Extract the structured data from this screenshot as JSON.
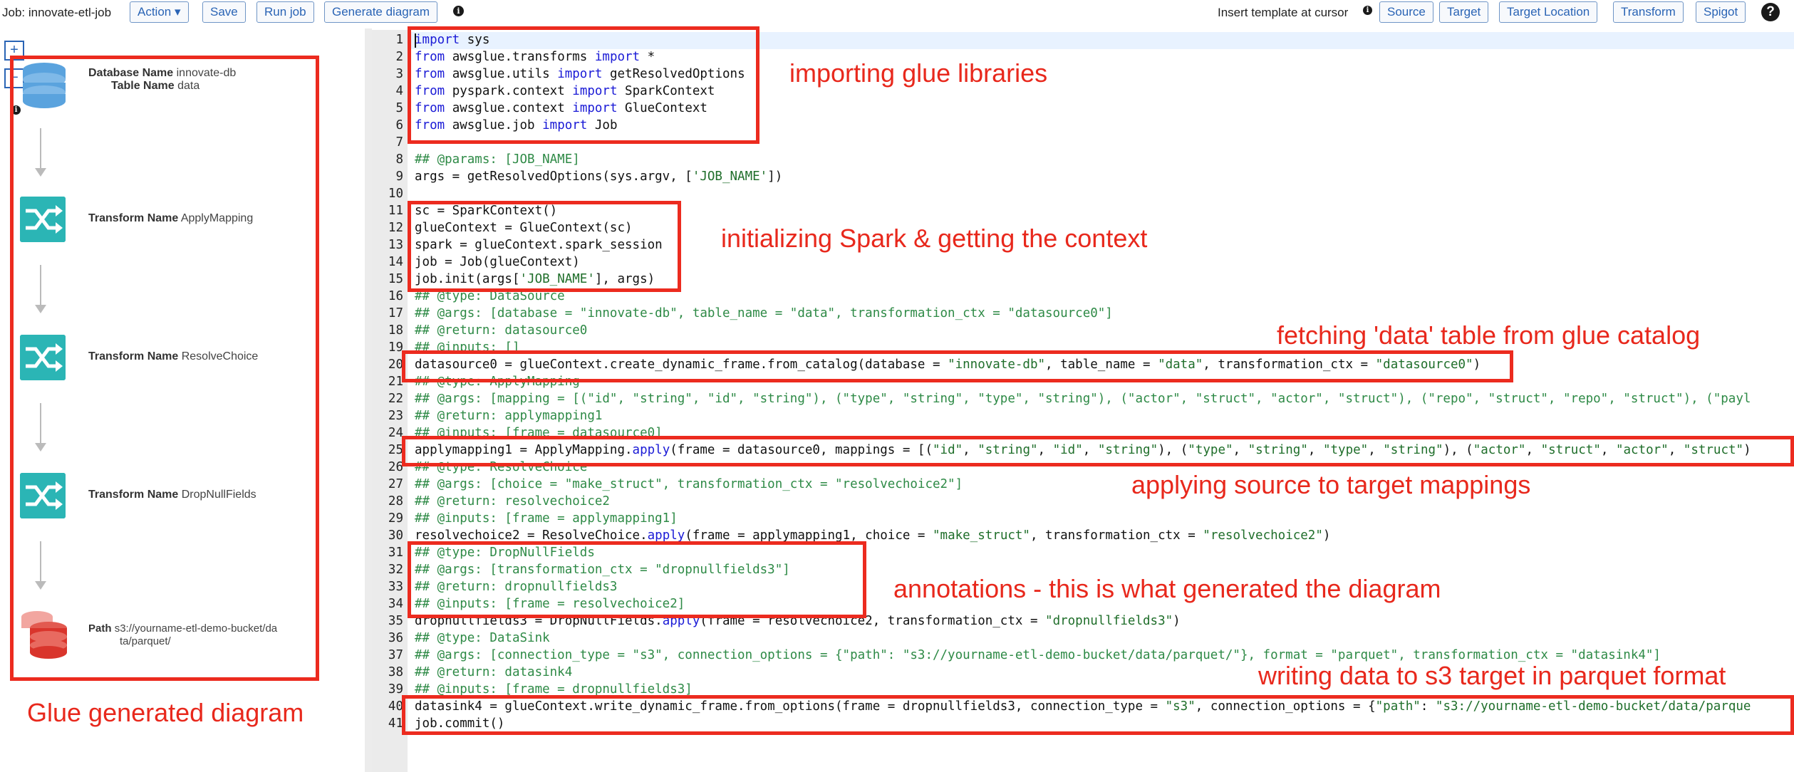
{
  "toolbar": {
    "job_label": "Job: innovate-etl-job",
    "action_label": "Action ▾",
    "save_label": "Save",
    "run_label": "Run job",
    "generate_label": "Generate diagram",
    "insert_template_label": "Insert template at cursor",
    "source_label": "Source",
    "target_label": "Target",
    "target_location_label": "Target Location",
    "transform_label": "Transform",
    "spigot_label": "Spigot",
    "help_label": "?"
  },
  "diagram": {
    "zoom_in": "+",
    "zoom_out": "−",
    "source_node": {
      "db_key": "Database Name",
      "db_value": "innovate-db",
      "table_key": "Table Name",
      "table_value": "data"
    },
    "transforms": [
      {
        "key": "Transform Name",
        "value": "ApplyMapping"
      },
      {
        "key": "Transform Name",
        "value": "ResolveChoice"
      },
      {
        "key": "Transform Name",
        "value": "DropNullFields"
      }
    ],
    "sink_node": {
      "path_key": "Path",
      "path_line1": "s3://yourname-etl-demo-bucket/da",
      "path_line2": "ta/parquet/"
    }
  },
  "code": {
    "line_numbers": [
      "1",
      "2",
      "3",
      "4",
      "5",
      "6",
      "7",
      "8",
      "9",
      "10",
      "11",
      "12",
      "13",
      "14",
      "15",
      "16",
      "17",
      "18",
      "19",
      "20",
      "21",
      "22",
      "23",
      "24",
      "25",
      "26",
      "27",
      "28",
      "29",
      "30",
      "31",
      "32",
      "33",
      "34",
      "35",
      "36",
      "37",
      "38",
      "39",
      "40",
      "41"
    ],
    "l1": [
      "import",
      " sys"
    ],
    "l2": [
      "from",
      " awsglue.transforms ",
      "import",
      " *"
    ],
    "l3": [
      "from",
      " awsglue.utils ",
      "import",
      " getResolvedOptions"
    ],
    "l4": [
      "from",
      " pyspark.context ",
      "import",
      " SparkContext"
    ],
    "l5": [
      "from",
      " awsglue.context ",
      "import",
      " GlueContext"
    ],
    "l6": [
      "from",
      " awsglue.job ",
      "import",
      " Job"
    ],
    "l8": "## @params: [JOB_NAME]",
    "l9": [
      "args = getResolvedOptions(sys.argv, [",
      "'JOB_NAME'",
      "])"
    ],
    "l11": "sc = SparkContext()",
    "l12": "glueContext = GlueContext(sc)",
    "l13": "spark = glueContext.spark_session",
    "l14": "job = Job(glueContext)",
    "l15": [
      "job.init(args[",
      "'JOB_NAME'",
      "], args)"
    ],
    "l16": "## @type: DataSource",
    "l17": "## @args: [database = \"innovate-db\", table_name = \"data\", transformation_ctx = \"datasource0\"]",
    "l18": "## @return: datasource0",
    "l19": "## @inputs: []",
    "l20": [
      "datasource0 = glueContext.create_dynamic_frame.from_catalog(database = ",
      "\"innovate-db\"",
      ", table_name = ",
      "\"data\"",
      ", transformation_ctx = ",
      "\"datasource0\"",
      ")"
    ],
    "l21": "## @type: ApplyMapping",
    "l22": "## @args: [mapping = [(\"id\", \"string\", \"id\", \"string\"), (\"type\", \"string\", \"type\", \"string\"), (\"actor\", \"struct\", \"actor\", \"struct\"), (\"repo\", \"struct\", \"repo\", \"struct\"), (\"payl",
    "l23": "## @return: applymapping1",
    "l24": "## @inputs: [frame = datasource0]",
    "l25": [
      "applymapping1 = ApplyMapping.",
      "apply",
      "(frame = datasource0, mappings = [(",
      "\"id\"",
      ", ",
      "\"string\"",
      ", ",
      "\"id\"",
      ", ",
      "\"string\"",
      "), (",
      "\"type\"",
      ", ",
      "\"string\"",
      ", ",
      "\"type\"",
      ", ",
      "\"string\"",
      "), (",
      "\"actor\"",
      ", ",
      "\"struct\"",
      ", ",
      "\"actor\"",
      ", ",
      "\"struct\"",
      ")"
    ],
    "l26": "## @type: ResolveChoice",
    "l27": "## @args: [choice = \"make_struct\", transformation_ctx = \"resolvechoice2\"]",
    "l28": "## @return: resolvechoice2",
    "l29": "## @inputs: [frame = applymapping1]",
    "l30": [
      "resolvechoice2 = ResolveChoice.",
      "apply",
      "(frame = applymapping1, choice = ",
      "\"make_struct\"",
      ", transformation_ctx = ",
      "\"resolvechoice2\"",
      ")"
    ],
    "l31": "## @type: DropNullFields",
    "l32": "## @args: [transformation_ctx = \"dropnullfields3\"]",
    "l33": "## @return: dropnullfields3",
    "l34": "## @inputs: [frame = resolvechoice2]",
    "l35": [
      "dropnullfields3 = DropNullFields.",
      "apply",
      "(frame = resolvechoice2, transformation_ctx = ",
      "\"dropnullfields3\"",
      ")"
    ],
    "l36": "## @type: DataSink",
    "l37": "## @args: [connection_type = \"s3\", connection_options = {\"path\": \"s3://yourname-etl-demo-bucket/data/parquet/\"}, format = \"parquet\", transformation_ctx = \"datasink4\"]",
    "l38": "## @return: datasink4",
    "l39": "## @inputs: [frame = dropnullfields3]",
    "l40": [
      "datasink4 = glueContext.write_dynamic_frame.from_options(frame = dropnullfields3, connection_type = ",
      "\"s3\"",
      ", connection_options = {",
      "\"path\"",
      ": ",
      "\"s3://yourname-etl-demo-bucket/data/parque"
    ],
    "l41": "job.commit()"
  },
  "annotations": {
    "importing": "importing glue libraries",
    "initializing": "initializing Spark & getting the context",
    "fetching": "fetching 'data' table from glue catalog",
    "applying": "applying source to target mappings",
    "annotations_note": "annotations - this is what generated the diagram",
    "writing": "writing data to s3 target in parquet format",
    "diagram_caption": "Glue generated diagram"
  },
  "colors": {
    "annotation_red": "#ec2b1f",
    "keyword_blue": "#1a1ad6",
    "comment_green": "#2e8a46",
    "button_blue": "#2a64b5",
    "transform_teal": "#2bb5b5",
    "db_blue": "#5aa3de",
    "s3_red": "#d9352c"
  }
}
